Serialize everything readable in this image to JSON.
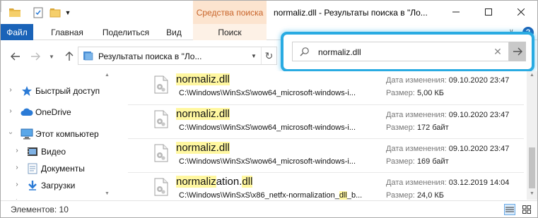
{
  "window": {
    "title": "normaliz.dll - Результаты поиска в \"Ло...",
    "context_tab_title": "Средства поиска"
  },
  "ribbon": {
    "tabs": [
      "Файл",
      "Главная",
      "Поделиться",
      "Вид",
      "Поиск"
    ],
    "help": "?"
  },
  "address": {
    "text": "Результаты поиска в \"Ло..."
  },
  "search": {
    "value": "normaliz.dll"
  },
  "nav": {
    "items": [
      {
        "label": "Быстрый доступ",
        "icon": "star-icon"
      },
      {
        "label": "OneDrive",
        "icon": "cloud-icon"
      },
      {
        "label": "Этот компьютер",
        "icon": "computer-icon"
      },
      {
        "label": "Видео",
        "icon": "video-folder-icon"
      },
      {
        "label": "Документы",
        "icon": "documents-folder-icon"
      },
      {
        "label": "Загрузки",
        "icon": "downloads-folder-icon"
      }
    ]
  },
  "results": {
    "date_label": "Дата изменения:",
    "size_label": "Размер:",
    "items": [
      {
        "name_hl": "normaliz.dll",
        "name_rest": "",
        "path": "C:\\Windows\\WinSxS\\wow64_microsoft-windows-i...",
        "date": "09.10.2020 23:47",
        "size": "5,00 КБ"
      },
      {
        "name_hl": "normaliz.dll",
        "name_rest": "",
        "path": "C:\\Windows\\WinSxS\\wow64_microsoft-windows-i...",
        "date": "09.10.2020 23:47",
        "size": "172 байт"
      },
      {
        "name_hl": "normaliz.dll",
        "name_rest": "",
        "path": "C:\\Windows\\WinSxS\\wow64_microsoft-windows-i...",
        "date": "09.10.2020 23:47",
        "size": "169 байт"
      },
      {
        "name_hl": "normaliz",
        "name_rest": "ation.",
        "name_hl2": "dll",
        "path_a": "C:\\Windows\\WinSxS\\x86_netfx-normalization_",
        "path_hl": "dll",
        "path_b": "_b...",
        "date": "03.12.2019 14:04",
        "size": "24,0 КБ"
      }
    ]
  },
  "status": {
    "count": "Элементов: 10"
  },
  "colors": {
    "accent": "#1a63b8",
    "context_tab": "#fce4cf",
    "highlight": "#fff7a0",
    "search_frame": "#29abe2"
  }
}
